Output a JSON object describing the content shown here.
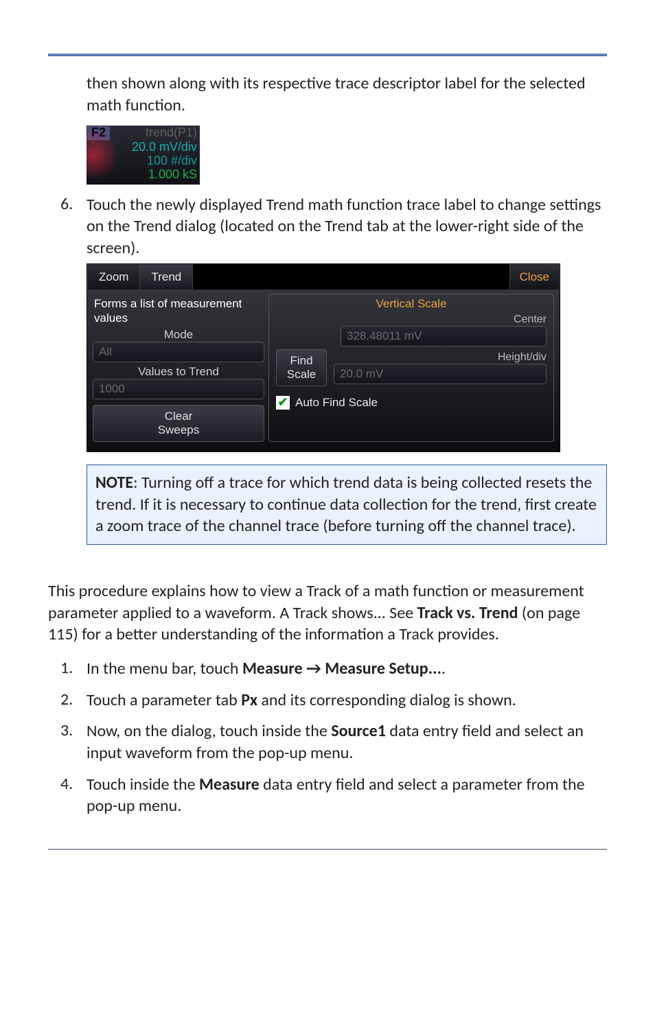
{
  "intro_cont": "then shown along with its respective trace descriptor label for the selected math function.",
  "trace_badge": {
    "fkey": "F2",
    "line1": "trend(P1)",
    "line2": "20.0 mV/div",
    "line3": "100 #/div",
    "line4": "1.000 kS"
  },
  "step6": {
    "num": "6.",
    "text": "Touch the newly displayed Trend math function trace label to change settings on the Trend dialog (located on the Trend tab at the lower-right side of the screen)."
  },
  "dialog": {
    "tabs": {
      "zoom": "Zoom",
      "trend": "Trend",
      "close": "Close"
    },
    "left": {
      "desc": "Forms a list of measurement values",
      "mode_label": "Mode",
      "mode_value": "All",
      "vtt_label": "Values to Trend",
      "vtt_value": "1000",
      "clear_btn_l1": "Clear",
      "clear_btn_l2": "Sweeps"
    },
    "right": {
      "title": "Vertical Scale",
      "center_label": "Center",
      "center_value": "328.48011 mV",
      "find_l1": "Find",
      "find_l2": "Scale",
      "height_label": "Height/div",
      "height_value": "20.0 mV",
      "auto": "Auto Find Scale"
    }
  },
  "note": {
    "bold": "NOTE",
    "text": ": Turning off a trace for which trend data is being collected resets the trend. If it is necessary to continue data collection for the trend, first create a zoom trace of the channel trace (before turning off the channel trace)."
  },
  "track_intro_a": "This procedure explains how to view a Track of a math function or measurement parameter applied to a waveform. A Track shows... See ",
  "track_intro_b": "Track vs. Trend",
  "track_intro_c": " (on page 115) for a better understanding of the information a Track provides.",
  "steps": {
    "s1": {
      "num": "1.",
      "a": "In the menu bar, touch ",
      "b": "Measure → Measure Setup...",
      "c": "."
    },
    "s2": {
      "num": "2.",
      "a": "Touch a parameter tab ",
      "b": "Px",
      "c": " and its corresponding dialog is shown."
    },
    "s3": {
      "num": "3.",
      "a": "Now, on the dialog, touch inside the ",
      "b": "Source1",
      "c": " data entry field and select an input waveform from the pop-up menu."
    },
    "s4": {
      "num": "4.",
      "a": "Touch inside the ",
      "b": "Measure",
      "c": " data entry field and select a parameter from the pop-up menu."
    }
  }
}
